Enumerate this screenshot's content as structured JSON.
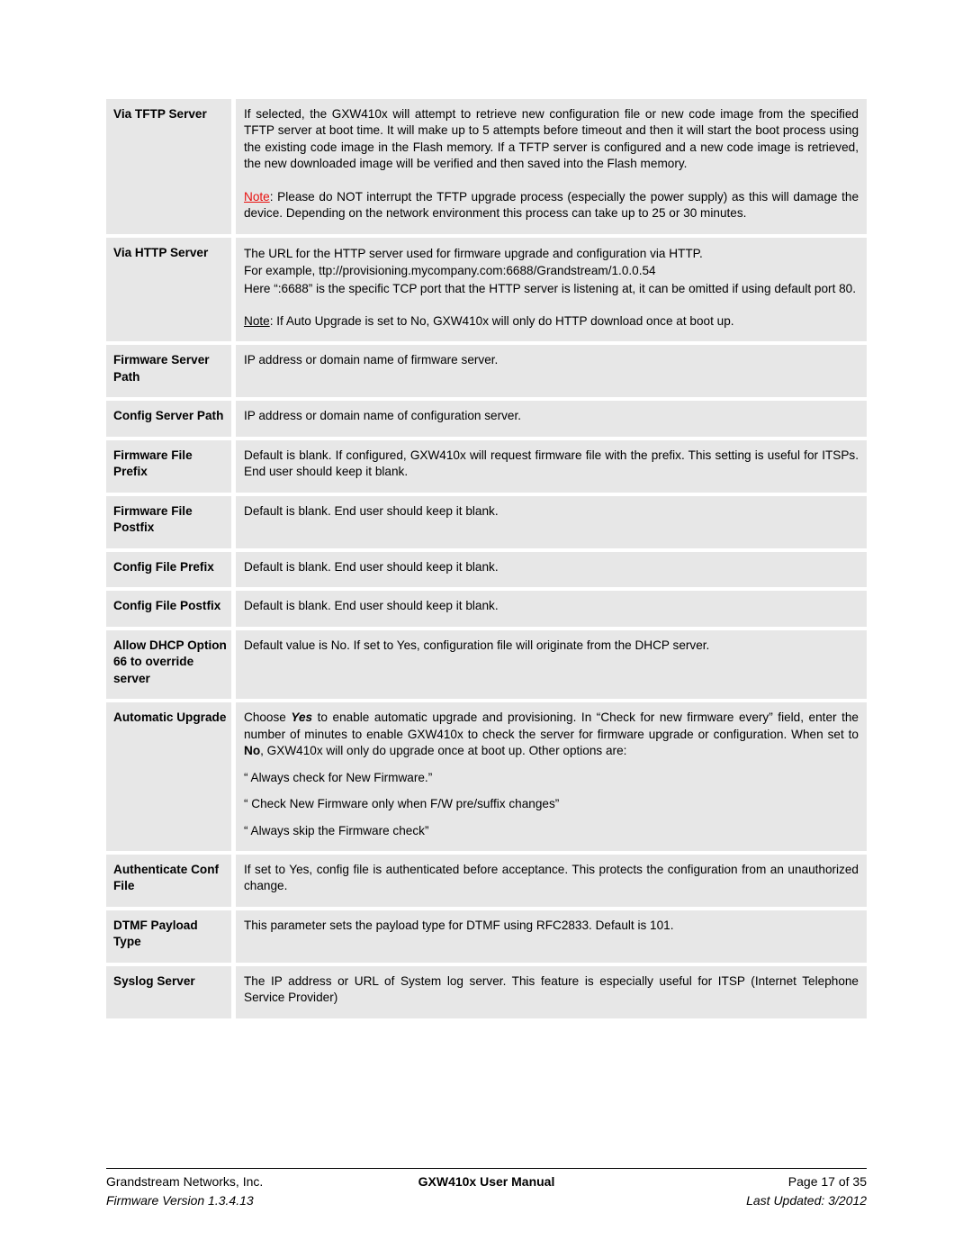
{
  "document": {
    "rows": [
      {
        "label": "Via TFTP Server",
        "paragraphs": [
          "If selected, the GXW410x will attempt to retrieve new configuration file or new code image from the specified TFTP server at boot time. It will make up to 5 attempts before timeout and then it will start the boot process using the existing code image in the Flash memory. If a TFTP server is configured and a new code image is retrieved, the new downloaded image will be verified and then saved into the Flash memory.",
          "Please do NOT interrupt the TFTP upgrade process (especially the power supply) as this will damage the device.  Depending on the network environment this process can take up to 25 or 30 minutes."
        ],
        "note_word": "Note",
        "note_color": "#e8100f"
      },
      {
        "label": "Via HTTP Server",
        "line1": "The URL for the HTTP server used for firmware upgrade and configuration via HTTP.",
        "line2": "For example, ttp://provisioning.mycompany.com:6688/Grandstream/1.0.0.54",
        "line3": "Here “:6688” is the specific TCP port that the HTTP server is listening at, it can be omitted if using default port 80.",
        "note_word": "Note",
        "note_body": ": If Auto Upgrade is set to No, GXW410x will only do HTTP download once at boot up."
      },
      {
        "label": "Firmware Server Path",
        "desc": "IP address or domain name of firmware server."
      },
      {
        "label": "Config Server Path",
        "desc": "IP address or domain name of configuration server."
      },
      {
        "label": "Firmware File Prefix",
        "desc": "Default is blank.  If configured, GXW410x will request firmware file with the prefix.  This setting is useful for ITSPs.  End user should keep it blank."
      },
      {
        "label": "Firmware File Postfix",
        "desc": "Default is blank.  End user should keep it blank."
      },
      {
        "label": "Config File Prefix",
        "desc": "Default is blank.  End user should keep it blank."
      },
      {
        "label": "Config File Postfix",
        "desc": "Default is blank.  End user should keep it blank."
      },
      {
        "label": "Allow DHCP Option 66 to override server",
        "desc": "Default value is No. If set to Yes, configuration file will originate from the DHCP server."
      },
      {
        "label": "Automatic Upgrade",
        "seg1": "Choose ",
        "yes": "Yes",
        "seg2": " to enable automatic upgrade and provisioning.  In “Check for new firmware every” field, enter the number of minutes to enable GXW410x to check the server for firmware upgrade or configuration.  When set to ",
        "no": "No",
        "seg3": ", GXW410x will only do upgrade once at boot up. Other options are:",
        "options": [
          "“ Always check for New Firmware.”",
          "“ Check New Firmware only when F/W pre/suffix changes”",
          "“ Always skip the Firmware check”"
        ]
      },
      {
        "label": "Authenticate Conf File",
        "desc": "If set to Yes, config file is authenticated before acceptance. This protects the configuration from an unauthorized change."
      },
      {
        "label": "DTMF Payload Type",
        "desc": "This parameter sets the payload type for DTMF using RFC2833. Default is 101."
      },
      {
        "label": "Syslog Server",
        "desc": "The IP address or URL of System log server. This feature is especially useful for ITSP (Internet Telephone Service Provider)"
      }
    ]
  },
  "footer": {
    "company": "Grandstream Networks, Inc.",
    "title": "GXW410x User Manual",
    "page": "Page 17 of 35",
    "firmware_version": "Firmware Version 1.3.4.13",
    "last_updated": "Last Updated: 3/2012"
  }
}
